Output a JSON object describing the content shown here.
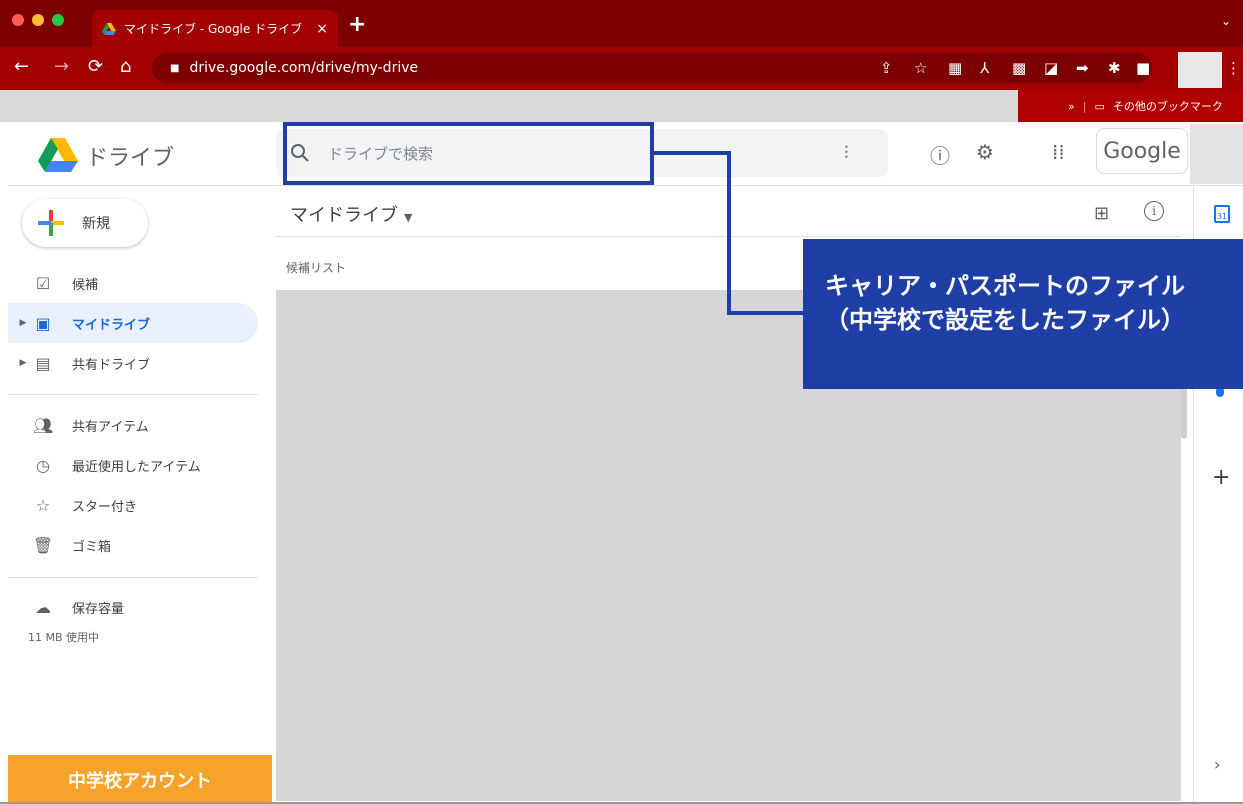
{
  "browser": {
    "tab_title": "マイドライブ - Google ドライブ",
    "tab_close": "×",
    "new_tab": "+",
    "tab_menu": "⌄",
    "url": "drive.google.com/drive/my-drive",
    "bookmarks_chevron": "»",
    "other_bookmarks": "その他のブックマーク",
    "traffic_colors": [
      "#ff5f57",
      "#febc2e",
      "#28c840"
    ]
  },
  "app": {
    "name": "ドライブ",
    "search_placeholder": "ドライブで検索",
    "google_label": "Google"
  },
  "sidebar": {
    "new_button": "新規",
    "items": [
      {
        "label": "候補",
        "icon": "check-square-icon"
      },
      {
        "label": "マイドライブ",
        "icon": "my-drive-icon",
        "active": true
      },
      {
        "label": "共有ドライブ",
        "icon": "shared-drives-icon"
      },
      {
        "label": "共有アイテム",
        "icon": "people-icon"
      },
      {
        "label": "最近使用したアイテム",
        "icon": "clock-icon"
      },
      {
        "label": "スター付き",
        "icon": "star-icon"
      },
      {
        "label": "ゴミ箱",
        "icon": "trash-icon"
      },
      {
        "label": "保存容量",
        "icon": "cloud-icon"
      }
    ],
    "storage_used": "11 MB 使用中",
    "school_account": "中学校アカウント"
  },
  "main": {
    "title": "マイドライブ",
    "section_label": "候補リスト"
  },
  "annotation": {
    "line1": "キャリア・パスポートのファイル",
    "line2": "（中学校で設定をしたファイル）",
    "color": "#1f3ea6"
  }
}
